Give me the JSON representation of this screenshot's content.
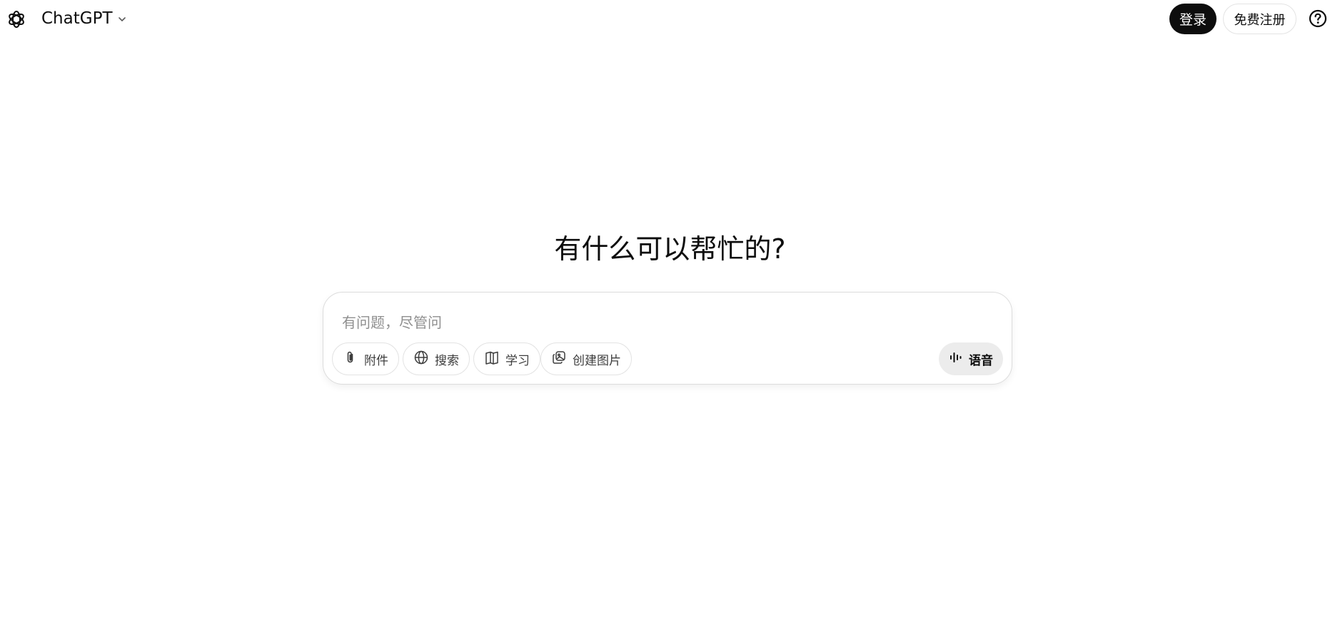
{
  "header": {
    "model_name": "ChatGPT",
    "login_label": "登录",
    "signup_label": "免费注册",
    "icons": {
      "logo": "openai-logo-icon",
      "dropdown": "chevron-down-icon",
      "help": "help-circle-icon"
    }
  },
  "main": {
    "headline": "有什么可以帮忙的?"
  },
  "composer": {
    "placeholder": "有问题，尽管问",
    "value": "",
    "tools": [
      {
        "label": "附件",
        "icon": "paperclip-icon"
      },
      {
        "label": "搜索",
        "icon": "globe-icon"
      },
      {
        "label": "学习",
        "icon": "book-icon"
      },
      {
        "label": "创建图片",
        "icon": "image-icon"
      }
    ],
    "voice_label": "语音",
    "voice_icon": "voice-wave-icon"
  },
  "colors": {
    "primary_button_bg": "#0d0d0d",
    "primary_button_text": "#ffffff",
    "voice_button_bg": "#ececec",
    "border": "#e3e3e3",
    "placeholder": "#8f8f8f"
  }
}
